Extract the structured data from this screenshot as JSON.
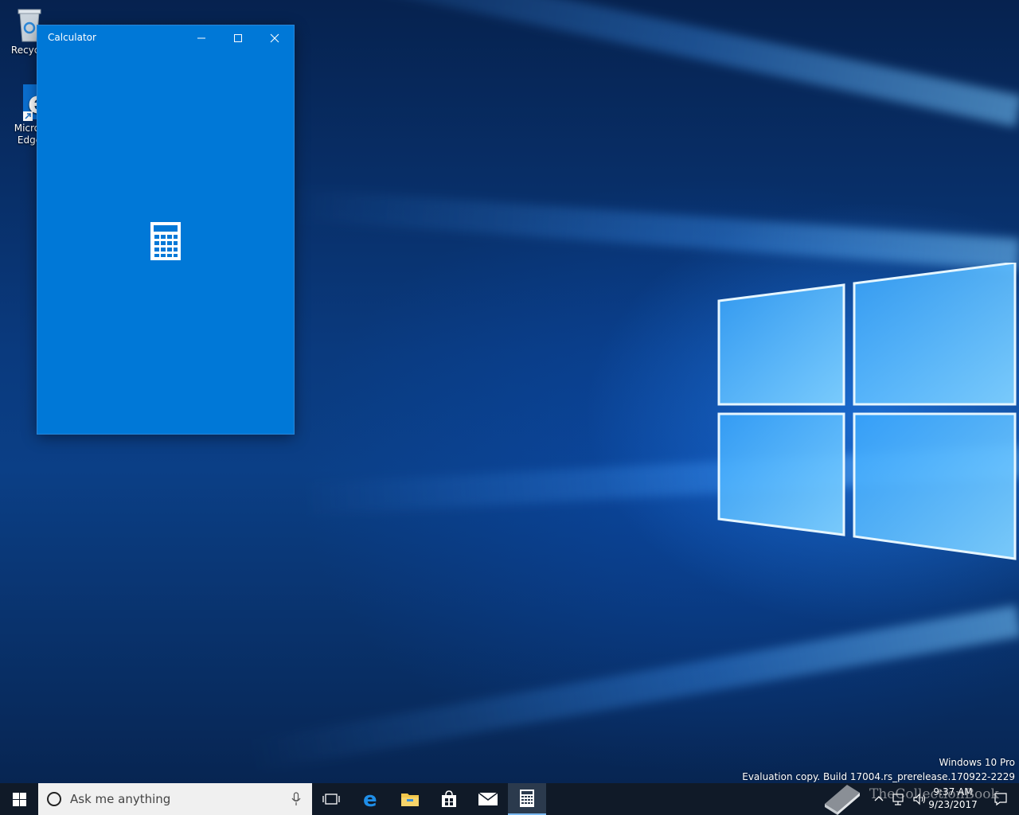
{
  "desktop": {
    "icons": [
      {
        "label_line1": "Recycle",
        "label_line2": ""
      },
      {
        "label_line1": "Micros",
        "label_line2": "Edge"
      }
    ],
    "watermark": {
      "line1": "Windows 10 Pro",
      "line2": "Evaluation copy. Build 17004.rs_prerelease.170922-2229"
    }
  },
  "calculator": {
    "title": "Calculator",
    "accent": "#0078d7",
    "icons": {
      "minimize": "minimize-icon",
      "maximize": "maximize-icon",
      "close": "close-icon",
      "splash": "calculator-icon"
    }
  },
  "taskbar": {
    "search_placeholder": "Ask me anything",
    "clock_time": "9:37 AM",
    "clock_date": "9/23/2017",
    "brand": "TheCollectionBook",
    "pinned": [
      "task-view-icon",
      "edge-icon",
      "file-explorer-icon",
      "store-icon",
      "mail-icon",
      "calculator-icon"
    ]
  }
}
